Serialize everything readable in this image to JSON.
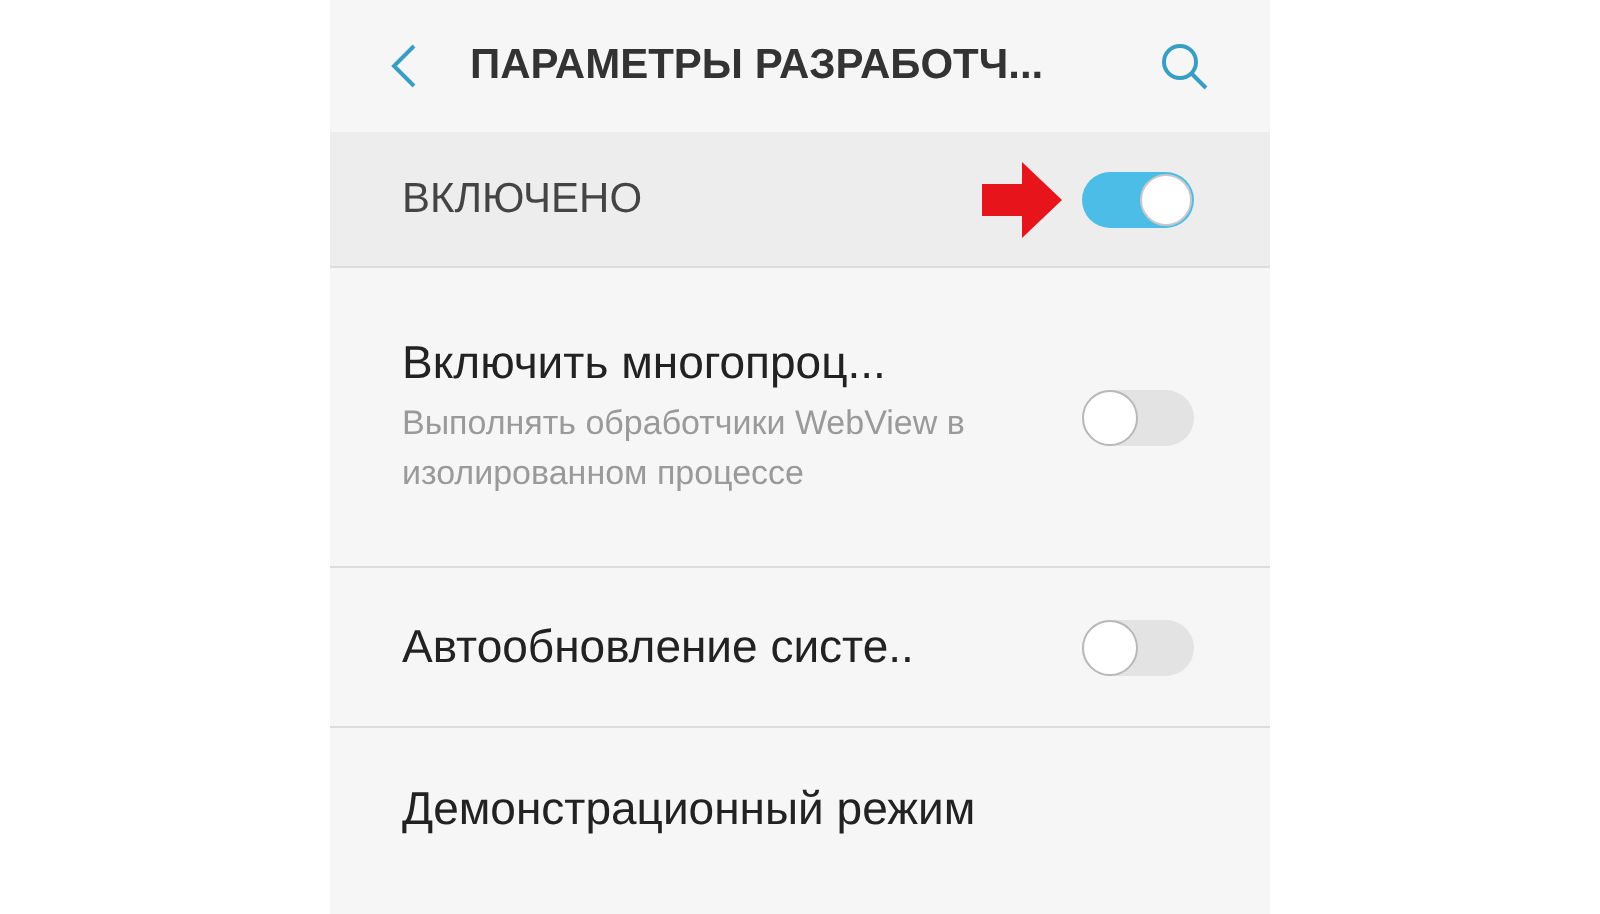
{
  "header": {
    "title": "ПАРАМЕТРЫ РАЗРАБОТЧ..."
  },
  "master_switch": {
    "label": "ВКЛЮЧЕНО",
    "on": true
  },
  "settings": [
    {
      "kind": "switch",
      "title": "Включить многопроц...",
      "summary": "Выполнять обработчики WebView в изолированном процессе",
      "on": false
    },
    {
      "kind": "switch",
      "title": "Автообновление систе..",
      "on": false
    },
    {
      "kind": "plain",
      "title": "Демонстрационный режим"
    }
  ]
}
